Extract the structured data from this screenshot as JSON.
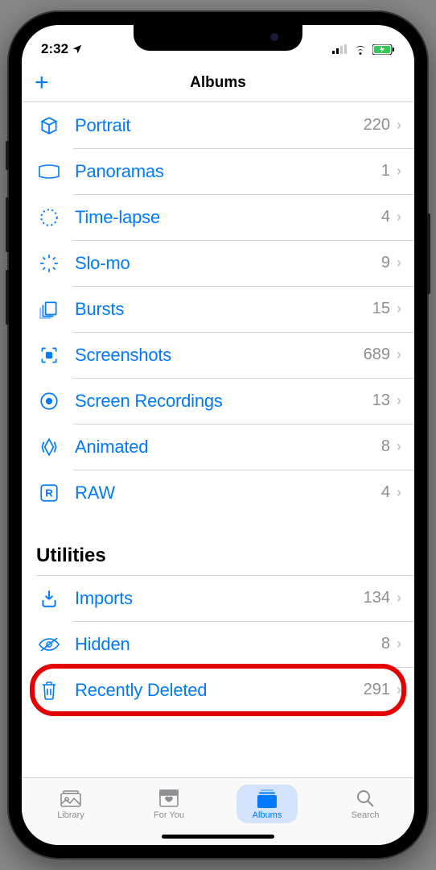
{
  "status_bar": {
    "time": "2:32"
  },
  "nav": {
    "title": "Albums",
    "add_label": "+"
  },
  "media_types": [
    {
      "icon": "portrait",
      "label": "Portrait",
      "count": "220"
    },
    {
      "icon": "panorama",
      "label": "Panoramas",
      "count": "1"
    },
    {
      "icon": "timelapse",
      "label": "Time-lapse",
      "count": "4"
    },
    {
      "icon": "slomo",
      "label": "Slo-mo",
      "count": "9"
    },
    {
      "icon": "bursts",
      "label": "Bursts",
      "count": "15"
    },
    {
      "icon": "screenshot",
      "label": "Screenshots",
      "count": "689"
    },
    {
      "icon": "screenrec",
      "label": "Screen Recordings",
      "count": "13"
    },
    {
      "icon": "animated",
      "label": "Animated",
      "count": "8"
    },
    {
      "icon": "raw",
      "label": "RAW",
      "count": "4"
    }
  ],
  "sections": {
    "utilities_title": "Utilities"
  },
  "utilities": [
    {
      "icon": "imports",
      "label": "Imports",
      "count": "134"
    },
    {
      "icon": "hidden",
      "label": "Hidden",
      "count": "8"
    },
    {
      "icon": "trash",
      "label": "Recently Deleted",
      "count": "291",
      "highlighted": true
    }
  ],
  "tabs": {
    "library": "Library",
    "for_you": "For You",
    "albums": "Albums",
    "search": "Search"
  }
}
